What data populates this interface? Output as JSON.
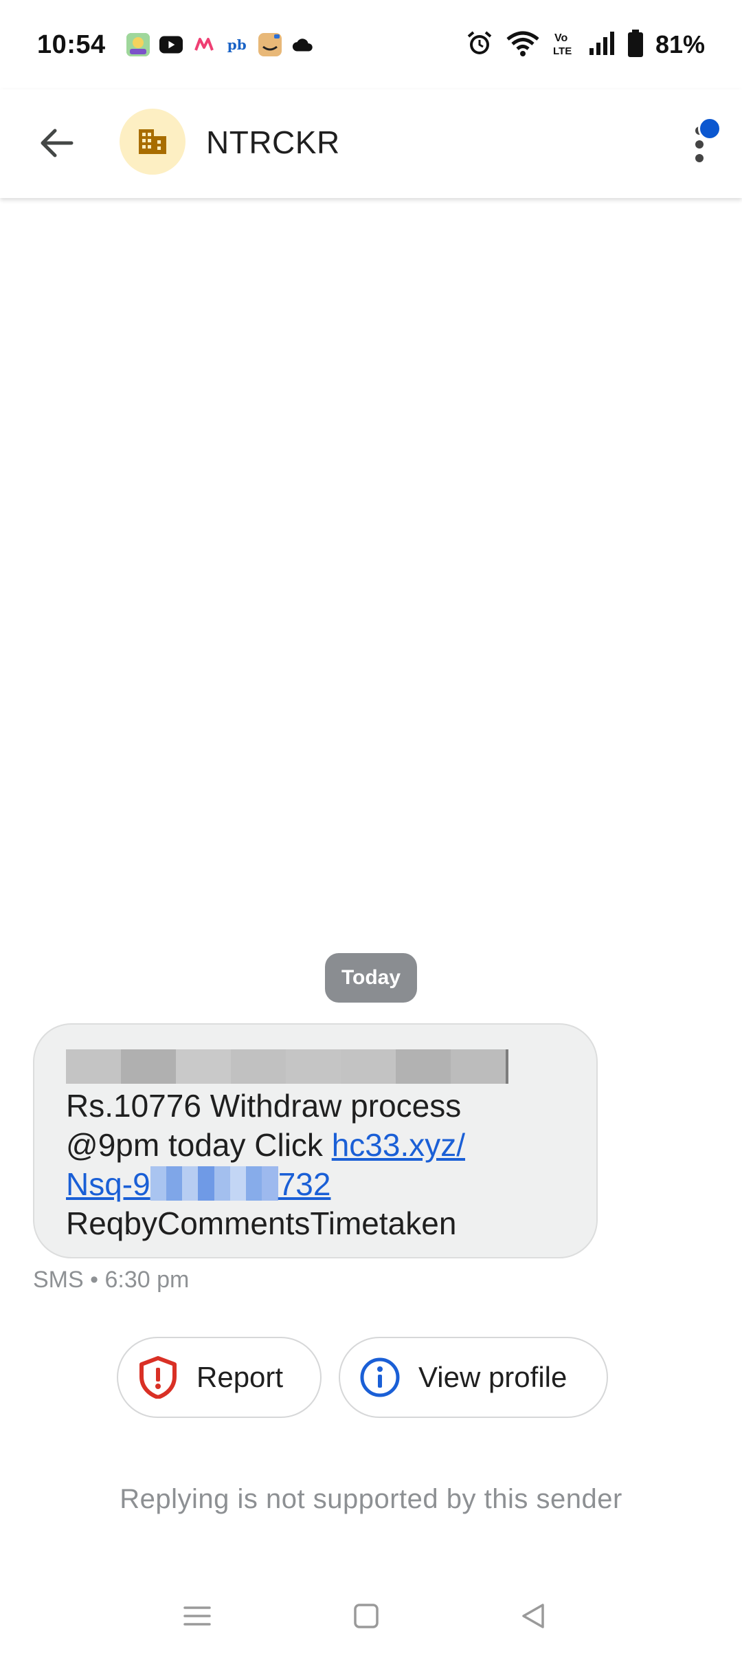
{
  "status_bar": {
    "time": "10:54",
    "battery": "81%",
    "app_icons": [
      "noise-app-icon",
      "youtube-icon",
      "myntra-icon",
      "policybazaar-icon",
      "amazon-icon",
      "cloud-icon"
    ],
    "system_icons": [
      "alarm-icon",
      "wifi-icon",
      "volte-icon",
      "signal-icon",
      "battery-icon"
    ]
  },
  "header": {
    "sender": "NTRCKR",
    "avatar_color": "#fdefc3",
    "notification_color": "#0b57d0"
  },
  "conversation": {
    "date_chip": "Today",
    "message": {
      "line1": "Rs.10776 Withdraw process",
      "line2_prefix": "@9pm today Click ",
      "link_part1": "hc33.xyz/",
      "link_part2_start": "Nsq-9",
      "link_part2_end": "732",
      "line4": "ReqbyCommentsTimetaken"
    },
    "meta": "SMS • 6:30 pm"
  },
  "actions": {
    "report_label": "Report",
    "profile_label": "View profile"
  },
  "reply_note": "Replying is not supported by this sender",
  "colors": {
    "link": "#1a5fd6",
    "report_red": "#d93025",
    "info_blue": "#1a5fd6"
  }
}
